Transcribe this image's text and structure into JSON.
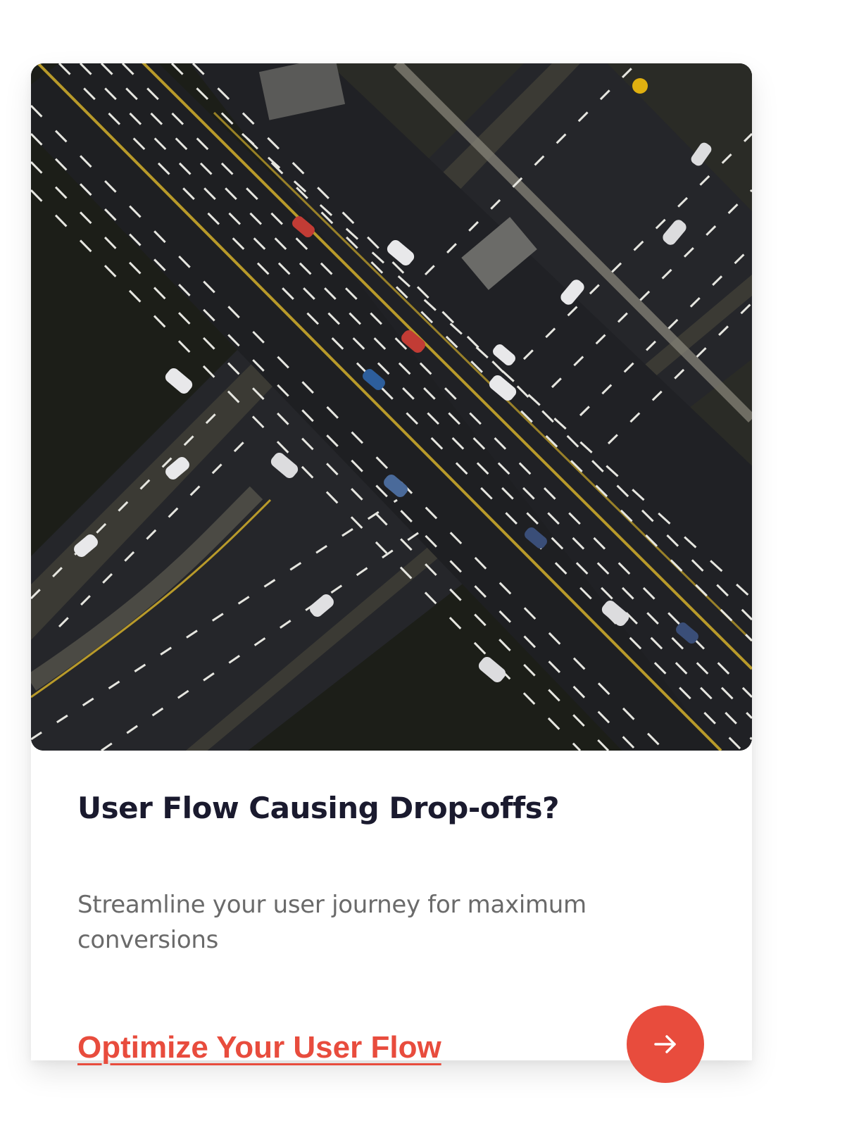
{
  "card": {
    "title": "User Flow Causing Drop-offs?",
    "description": "Streamline your user journey for maximum conversions",
    "cta_label": "Optimize Your User Flow",
    "arrow_icon": "arrow-right-icon",
    "image_subject": "aerial-highway-interchange-photo"
  },
  "colors": {
    "accent": "#e84c3d",
    "title": "#1a1a2e",
    "description": "#6a6a6a",
    "background": "#ffffff"
  }
}
